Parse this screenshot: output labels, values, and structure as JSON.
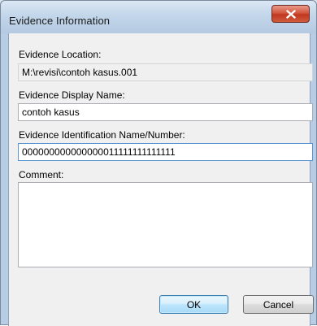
{
  "window": {
    "title": "Evidence Information",
    "close_symbol": "x"
  },
  "form": {
    "location_label": "Evidence Location:",
    "location_value": "M:\\revisi\\contoh kasus.001",
    "display_name_label": "Evidence Display Name:",
    "display_name_value": "contoh kasus",
    "identification_label": "Evidence Identification Name/Number:",
    "identification_value": "000000000000000011111111111111",
    "comment_label": "Comment:",
    "comment_value": ""
  },
  "buttons": {
    "ok_label": "OK",
    "cancel_label": "Cancel"
  },
  "icons": {
    "close": "close-icon"
  }
}
